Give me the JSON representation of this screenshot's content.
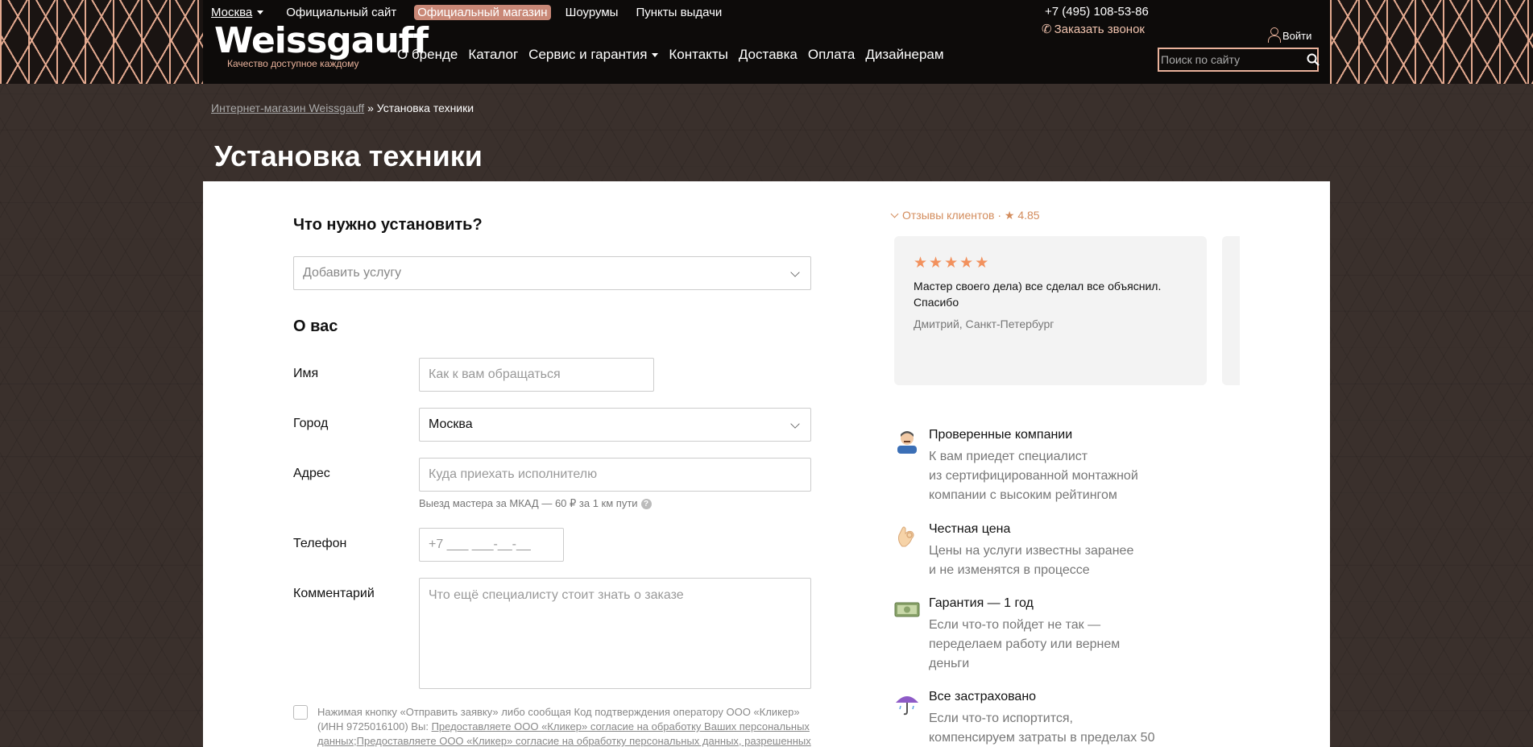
{
  "header": {
    "city": "Москва",
    "top_links": [
      "Официальный сайт",
      "Официальный магазин",
      "Шоурумы",
      "Пункты выдачи"
    ],
    "active_top_link": "Официальный магазин",
    "logo": {
      "brand": "Weissgauff",
      "slogan": "Качество доступное каждому"
    },
    "main_nav": [
      "О бренде",
      "Каталог",
      "Сервис и гарантия",
      "Контакты",
      "Доставка",
      "Оплата",
      "Дизайнерам"
    ],
    "phone": "+7 (495) 108-53-86",
    "callback": "Заказать звонок",
    "login": "Войти",
    "search_placeholder": "Поиск по сайту"
  },
  "breadcrumb": {
    "home": "Интернет-магазин Weissgauff",
    "separator": " » ",
    "current": "Установка техники"
  },
  "page_title": "Установка техники",
  "form": {
    "service_section_title": "Что нужно установить?",
    "service_placeholder": "Добавить услугу",
    "about_section_title": "О вас",
    "name_label": "Имя",
    "name_placeholder": "Как к вам обращаться",
    "city_label": "Город",
    "city_value": "Москва",
    "address_label": "Адрес",
    "address_placeholder": "Куда приехать исполнителю",
    "address_hint": "Выезд мастера за МКАД — 60 ₽ за 1 км пути",
    "phone_label": "Телефон",
    "phone_placeholder": "+7 ___ ___-__-__",
    "comment_label": "Комментарий",
    "comment_placeholder": "Что ещё специалисту стоит знать о заказе",
    "consent_text": "Нажимая кнопку «Отправить заявку» либо сообщая Код подтверждения оператору ООО «Кликер» (ИНН 9725016100) Вы:",
    "consent_link_1": "Предоставляете ООО «Кликер» согласие на обработку Ваших персональных данных",
    "consent_sep": ";",
    "consent_link_2": "Предоставляете ООО «Кликер» согласие на обработку персональных данных, разрешенных"
  },
  "reviews": {
    "toggle_label": "Отзывы клиентов · ★ 4.85",
    "items": [
      {
        "stars": 5,
        "text": "Мастер своего дела) все сделал все объяснил. Спасибо",
        "author": "Дмитрий, Санкт-Петербург"
      }
    ]
  },
  "features": [
    {
      "icon": "mechanic-icon",
      "title": "Проверенные компании",
      "desc": "К вам приедет специалист\nиз сертифицированной монтажной\nкомпании с высоким рейтингом"
    },
    {
      "icon": "ok-hand-icon",
      "title": "Честная цена",
      "desc": "Цены на услуги известны заранее\nи не изменятся в процессе"
    },
    {
      "icon": "money-icon",
      "title": "Гарантия — 1 год",
      "desc": "Если что-то пойдет не так —\nпеределаем работу или вернем\nденьги"
    },
    {
      "icon": "umbrella-icon",
      "title": "Все застраховано",
      "desc": "Если что-то испортится,\nкомпенсируем затраты в пределах 50"
    }
  ],
  "colors": {
    "accent": "#e9b29b",
    "header_bg": "#0d0b0a",
    "page_bg": "#3a302c",
    "star": "#f2915d",
    "link_orange": "#d38c5c"
  }
}
